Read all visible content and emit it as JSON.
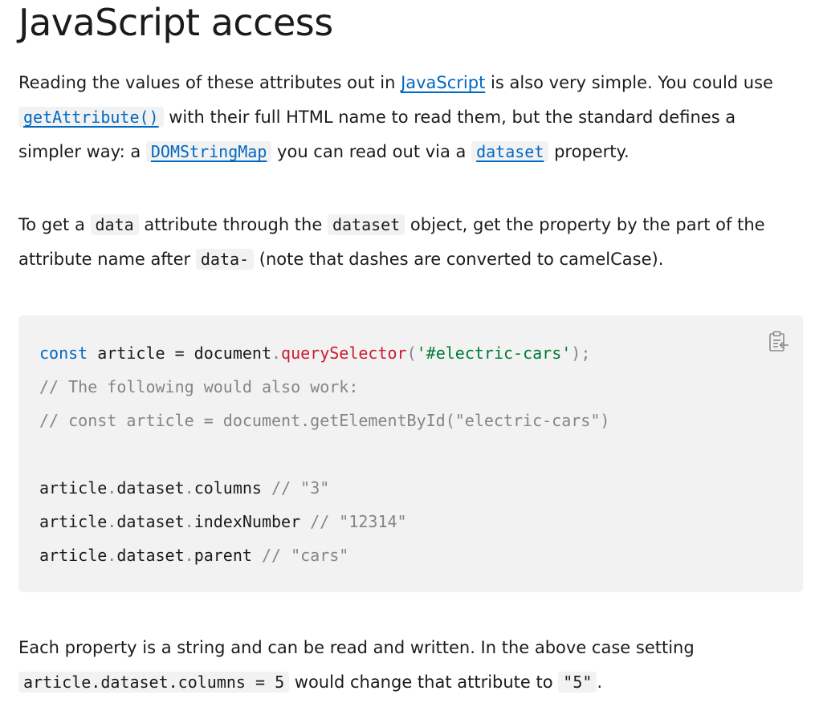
{
  "heading": "JavaScript access",
  "para1": {
    "t1": "Reading the values of these attributes out in ",
    "link_js": "JavaScript",
    "t2": " is also very simple. You could use ",
    "code_getattr": "getAttribute()",
    "t3": " with their full HTML name to read them, but the standard defines a simpler way: a ",
    "code_domstringmap": "DOMStringMap",
    "t4": " you can read out via a ",
    "code_dataset": "dataset",
    "t5": " property."
  },
  "para2": {
    "t1": "To get a ",
    "code_data": "data",
    "t2": " attribute through the ",
    "code_dataset": "dataset",
    "t3": " object, get the property by the part of the attribute name after ",
    "code_data_dash": "data-",
    "t4": " (note that dashes are converted to camelCase)."
  },
  "code": {
    "l1_kw": "const",
    "l1_a": " article = document",
    "l1_dot": ".",
    "l1_fn": "querySelector",
    "l1_p1": "(",
    "l1_str": "'#electric-cars'",
    "l1_p2": ");",
    "l2": "// The following would also work:",
    "l3": "// const article = document.getElementById(\"electric-cars\")",
    "l5_a": "article",
    "l5_d1": ".",
    "l5_b": "dataset",
    "l5_d2": ".",
    "l5_c": "columns",
    "l5_com": " // \"3\"",
    "l6_a": "article",
    "l6_d1": ".",
    "l6_b": "dataset",
    "l6_d2": ".",
    "l6_c": "indexNumber",
    "l6_com": " // \"12314\"",
    "l7_a": "article",
    "l7_d1": ".",
    "l7_b": "dataset",
    "l7_d2": ".",
    "l7_c": "parent",
    "l7_com": " // \"cars\""
  },
  "para3": {
    "t1": "Each property is a string and can be read and written. In the above case setting ",
    "code_assign": "article.dataset.columns = 5",
    "t2": " would change that attribute to ",
    "code_five": "\"5\"",
    "t3": "."
  },
  "colors": {
    "link": "#0069c2",
    "keyword": "#0069c2",
    "function": "#c81c31",
    "string": "#007936",
    "comment": "#858585",
    "code_bg": "#f2f2f2"
  },
  "icons": {
    "copy": "clipboard-copy-icon"
  }
}
